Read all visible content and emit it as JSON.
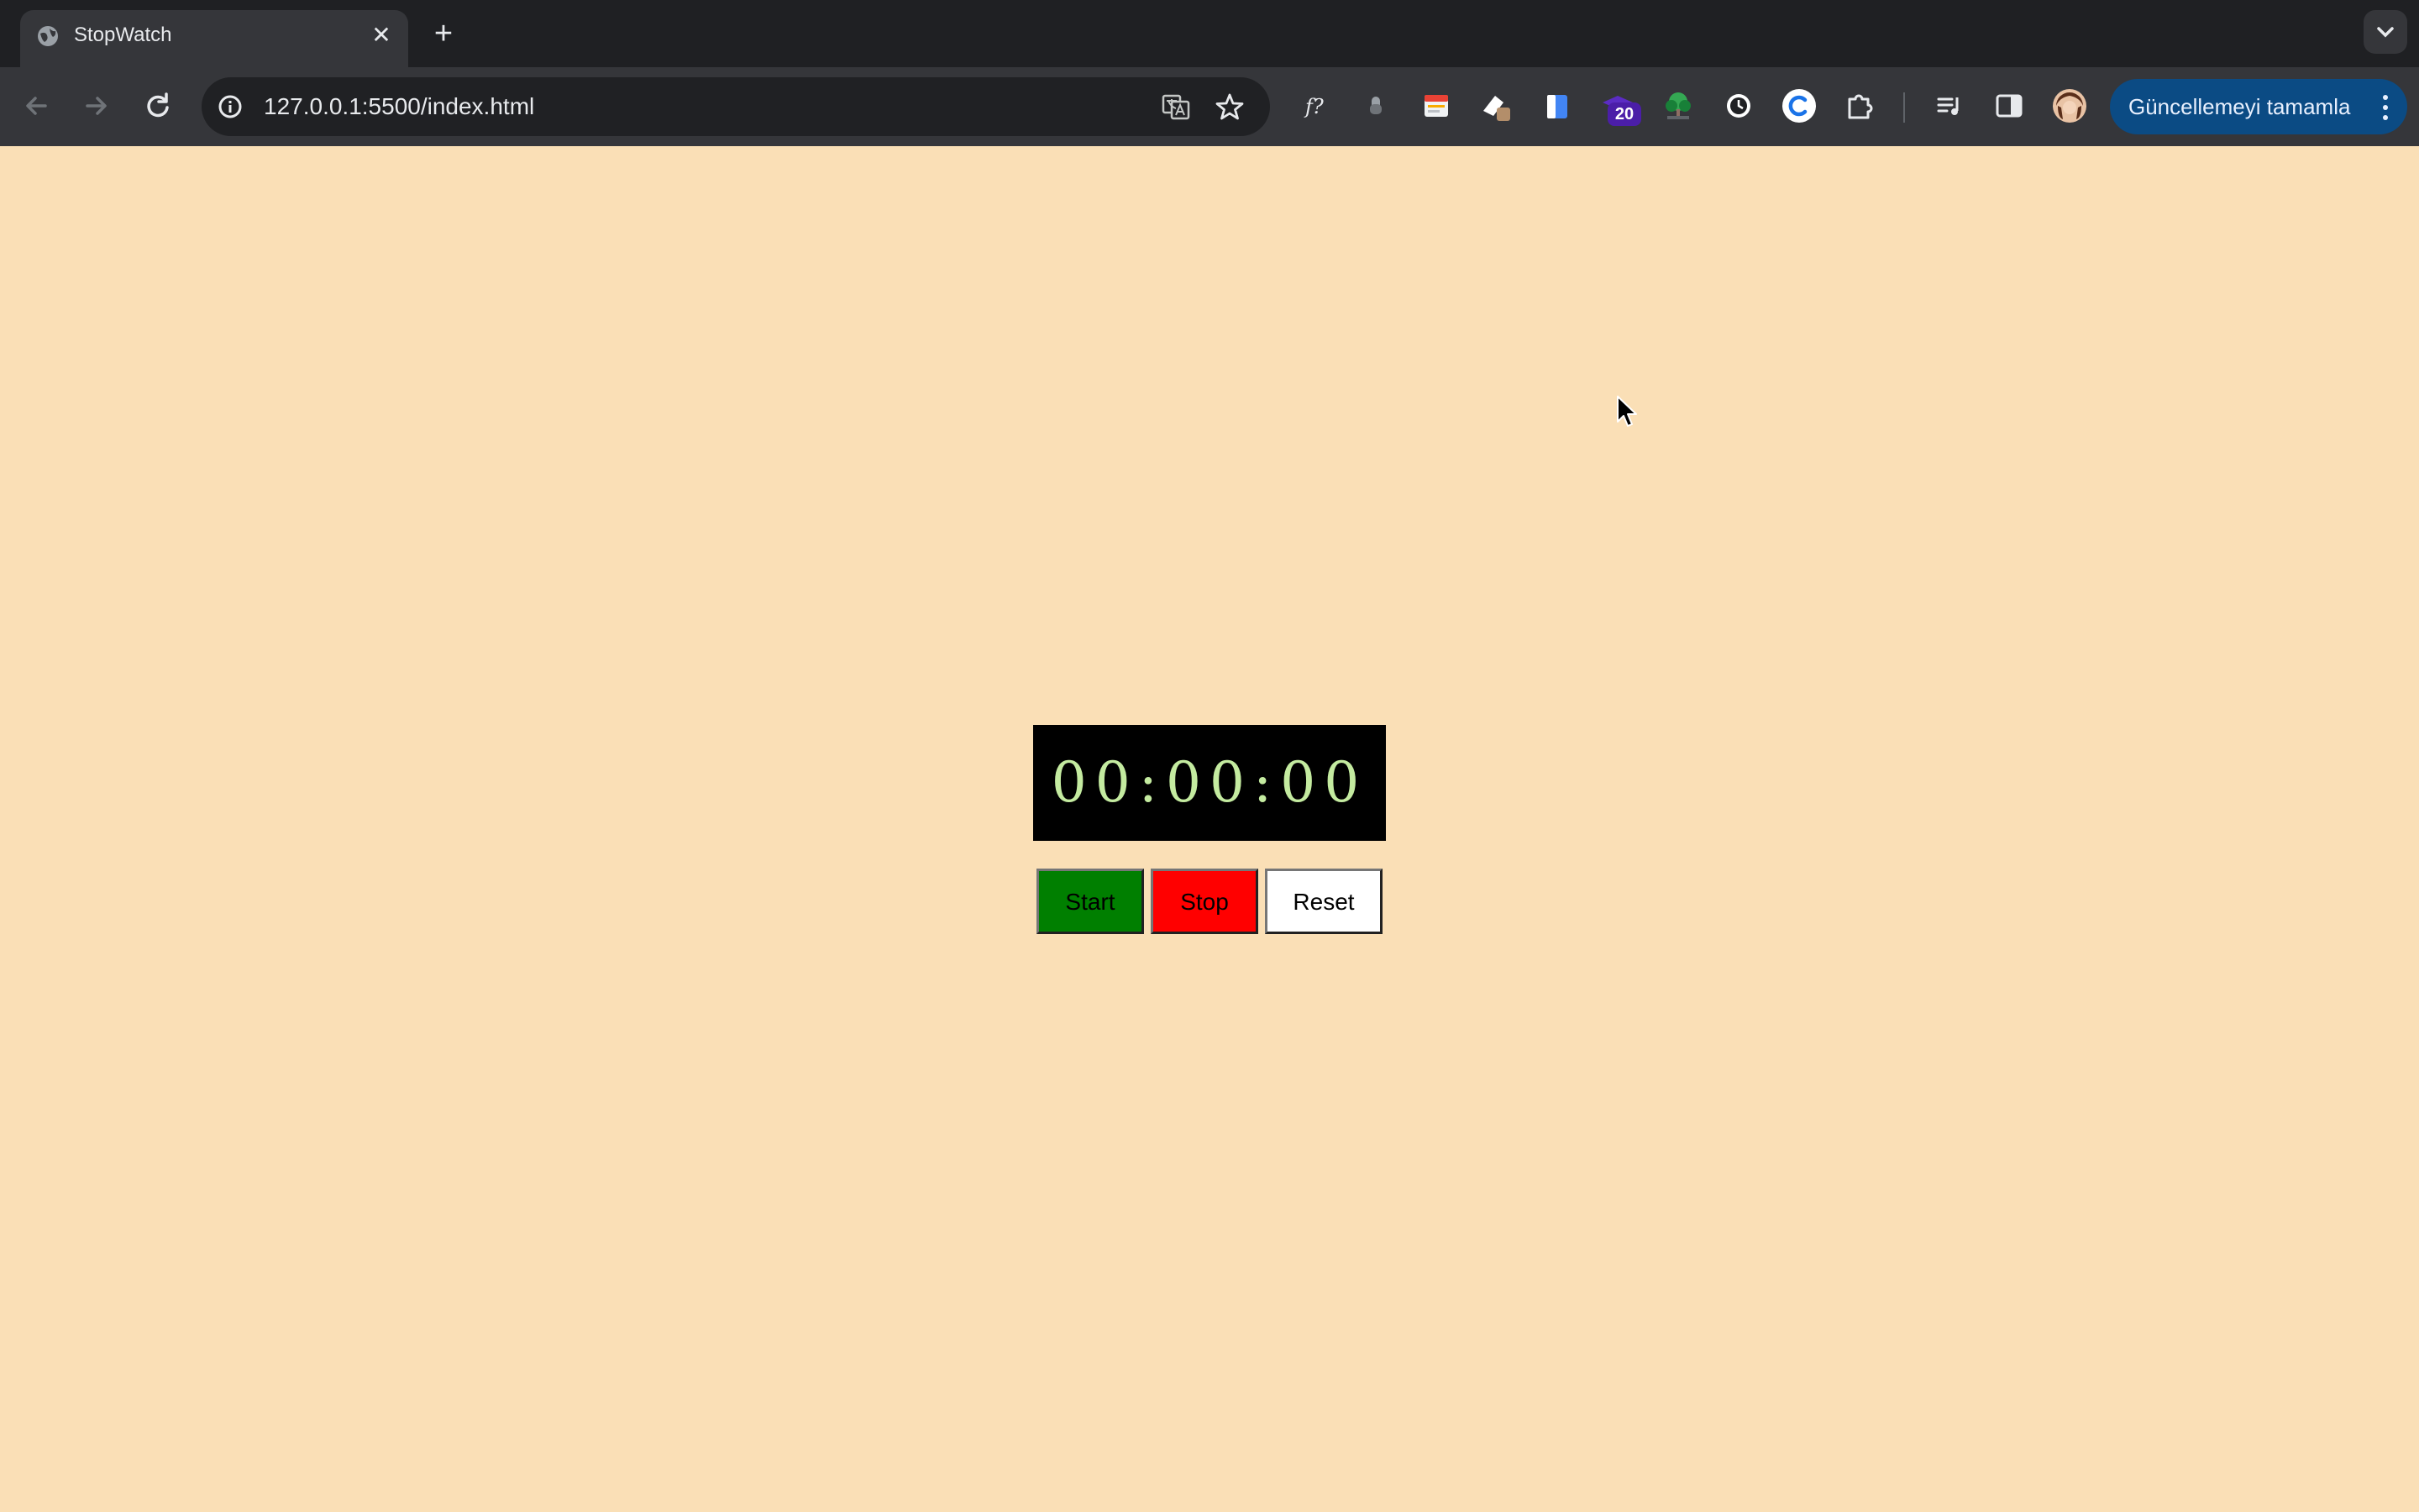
{
  "browser": {
    "tab": {
      "title": "StopWatch",
      "close_glyph": "✕"
    },
    "new_tab_glyph": "+",
    "address_bar": {
      "url": "127.0.0.1:5500/index.html"
    },
    "extensions": {
      "badge_count": "20"
    },
    "update_button": {
      "label": "Güncellemeyi tamamla"
    }
  },
  "stopwatch": {
    "display": "00:00:00",
    "buttons": {
      "start_label": "Start",
      "stop_label": "Stop",
      "reset_label": "Reset"
    }
  },
  "colors": {
    "page_background": "#fadfb6",
    "display_background": "#000000",
    "display_text": "#c4eba0",
    "start_button": "#007f00",
    "stop_button": "#ff0000",
    "reset_button": "#ffffff"
  }
}
